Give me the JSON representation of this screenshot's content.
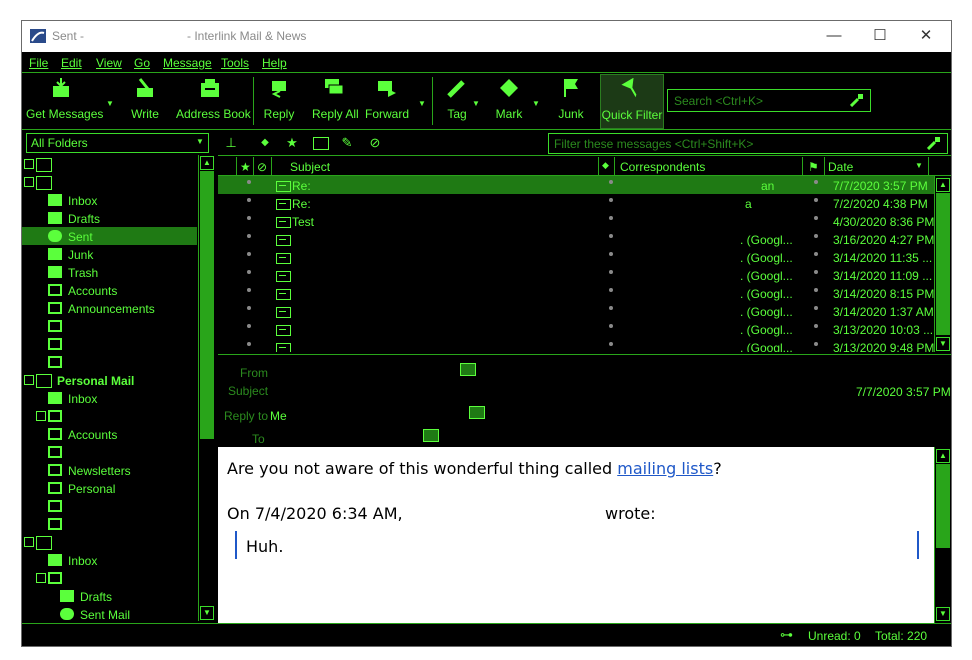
{
  "window": {
    "title_left": "Sent -",
    "title_right": "- Interlink Mail & News",
    "minimize": "—",
    "maximize": "☐",
    "close": "✕"
  },
  "menu": [
    "File",
    "Edit",
    "View",
    "Go",
    "Message",
    "Tools",
    "Help"
  ],
  "toolbar": {
    "get_messages": "Get Messages",
    "write": "Write",
    "address_book": "Address Book",
    "reply": "Reply",
    "reply_all": "Reply All",
    "forward": "Forward",
    "tag": "Tag",
    "mark": "Mark",
    "junk": "Junk",
    "quick_filter": "Quick Filter",
    "search_placeholder": "Search <Ctrl+K>"
  },
  "folder_pane": {
    "selector": "All Folders",
    "account1": [
      {
        "label": "Inbox",
        "icon": "inbox-icon"
      },
      {
        "label": "Drafts",
        "icon": "drafts-icon"
      },
      {
        "label": "Sent",
        "icon": "sent-icon"
      },
      {
        "label": "Junk",
        "icon": "junk-icon"
      },
      {
        "label": "Trash",
        "icon": "trash-icon"
      },
      {
        "label": "Accounts",
        "icon": "folder-icon"
      },
      {
        "label": "Announcements",
        "icon": "folder-icon"
      }
    ],
    "personal_mail": "Personal Mail",
    "account2": [
      {
        "label": "Inbox",
        "icon": "inbox-icon"
      },
      {
        "label": "Accounts",
        "icon": "folder-icon"
      },
      {
        "label": "Newsletters",
        "icon": "folder-icon"
      },
      {
        "label": "Personal",
        "icon": "folder-icon"
      }
    ],
    "account3": [
      {
        "label": "Inbox",
        "icon": "inbox-icon"
      },
      {
        "label": "Drafts",
        "icon": "drafts-icon"
      },
      {
        "label": "Sent Mail",
        "icon": "sent-icon"
      }
    ]
  },
  "filter_bar": {
    "placeholder": "Filter these messages <Ctrl+Shift+K>"
  },
  "thread_pane": {
    "columns": {
      "subject": "Subject",
      "correspondents": "Correspondents",
      "date": "Date"
    },
    "rows": [
      {
        "subject": "Re:",
        "correspondent": "an",
        "date": "7/7/2020 3:57 PM",
        "selected": true
      },
      {
        "subject": "Re:",
        "correspondent": "a",
        "date": "7/2/2020 4:38 PM"
      },
      {
        "subject": "Test",
        "correspondent": "",
        "date": "4/30/2020 8:36 PM"
      },
      {
        "subject": "",
        "correspondent": ". (Googl...",
        "date": "3/16/2020 4:27 PM"
      },
      {
        "subject": "",
        "correspondent": ". (Googl...",
        "date": "3/14/2020 11:35 ..."
      },
      {
        "subject": "",
        "correspondent": ". (Googl...",
        "date": "3/14/2020 11:09 ..."
      },
      {
        "subject": "",
        "correspondent": ". (Googl...",
        "date": "3/14/2020 8:15 PM"
      },
      {
        "subject": "",
        "correspondent": ". (Googl...",
        "date": "3/14/2020 1:37 AM"
      },
      {
        "subject": "",
        "correspondent": ". (Googl...",
        "date": "3/13/2020 10:03 ..."
      },
      {
        "subject": "",
        "correspondent": ". (Googl...",
        "date": "3/13/2020 9:48 PM"
      }
    ]
  },
  "message_header": {
    "from_label": "From",
    "subject_label": "Subject",
    "reply_to_label": "Reply to",
    "reply_to_value": "Me",
    "to_label": "To",
    "date": "7/7/2020 3:57 PM"
  },
  "message_body": {
    "line1_prefix": "Are you not aware of this wonderful thing called ",
    "link": "mailing lists",
    "line1_suffix": "?",
    "line2": "On 7/4/2020 6:34 AM,",
    "line2_end": "wrote:",
    "quote": "Huh."
  },
  "status_bar": {
    "unread": "Unread: 0",
    "total": "Total: 220"
  }
}
